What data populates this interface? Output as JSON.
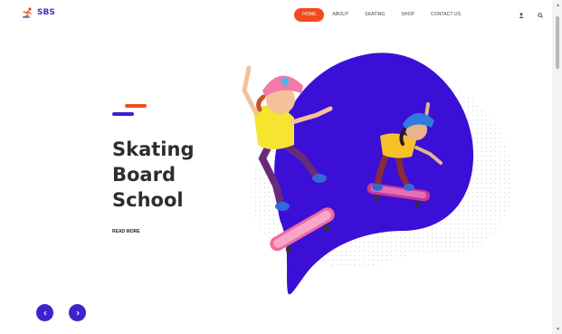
{
  "brand": {
    "name": "SBS",
    "accent_color": "#f24b1d",
    "primary_color": "#3b1fd0"
  },
  "nav": {
    "items": [
      {
        "label": "HOME",
        "active": true
      },
      {
        "label": "ABOUT",
        "active": false
      },
      {
        "label": "SKATING",
        "active": false
      },
      {
        "label": "SHOP",
        "active": false
      },
      {
        "label": "CONTACT US",
        "active": false
      }
    ],
    "icons": [
      "user-icon",
      "search-icon"
    ]
  },
  "hero": {
    "title_lines": [
      "Skating",
      "Board",
      "School"
    ],
    "cta_label": "READ MORE",
    "illustration": "two-kids-skateboarding"
  },
  "slider": {
    "prev_icon": "arrow-left-icon",
    "next_icon": "arrow-right-icon"
  }
}
